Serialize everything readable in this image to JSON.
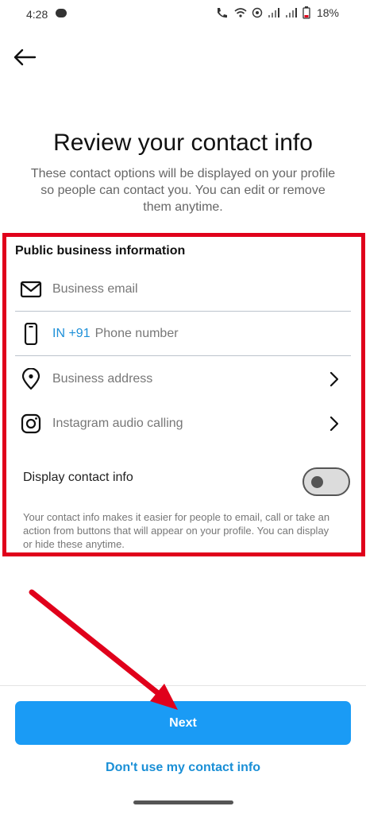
{
  "status_bar": {
    "time": "4:28",
    "battery": "18%"
  },
  "header": {
    "title": "Review your contact info",
    "subtitle": "These contact options will be displayed on your profile so people can contact you. You can edit or remove them anytime."
  },
  "public_info": {
    "section_title": "Public business information",
    "email_placeholder": "Business email",
    "phone_country": "IN +91",
    "phone_placeholder": "Phone number",
    "address_label": "Business address",
    "audio_calling_label": "Instagram audio calling",
    "display_label": "Display contact info",
    "display_enabled": false,
    "help_text": "Your contact info makes it easier for people to email, call or take an action from buttons that will appear on your profile. You can display or hide these anytime."
  },
  "footer": {
    "next_label": "Next",
    "alt_link": "Don't use my contact info"
  },
  "colors": {
    "accent": "#1a9bf5",
    "link": "#1a8fd6",
    "annotation": "#e0001b"
  },
  "icons": [
    "message-icon",
    "wifi-calling-icon",
    "wifi-icon",
    "hotspot-icon",
    "signal-icon",
    "battery-icon",
    "back-arrow-icon",
    "mail-icon",
    "phone-icon",
    "location-pin-icon",
    "instagram-icon",
    "chevron-right-icon"
  ]
}
